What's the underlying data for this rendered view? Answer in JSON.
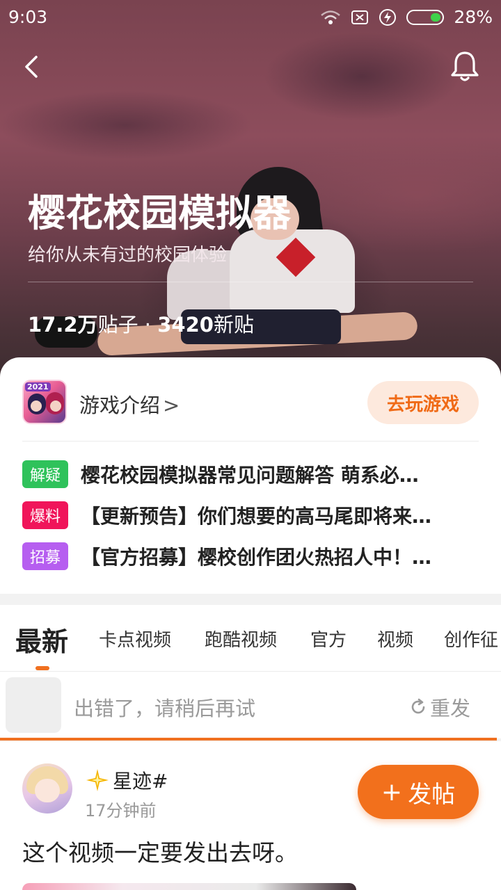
{
  "status_bar": {
    "time": "9:03",
    "battery": "28%"
  },
  "header": {
    "title": "樱花校园模拟器",
    "subtitle": "给你从未有过的校园体验",
    "stats": {
      "posts": "17.2万",
      "posts_label": "贴子",
      "separator": " · ",
      "new": "3420",
      "new_label": "新贴"
    }
  },
  "game_card": {
    "intro_label": "游戏介绍",
    "intro_chevron": ">",
    "icon_badge": "2021",
    "play_button": "去玩游戏"
  },
  "notices": [
    {
      "badge": "解疑",
      "badge_color": "#2fc25b",
      "text": "樱花校园模拟器常见问题解答 萌系必…"
    },
    {
      "badge": "爆料",
      "badge_color": "#f0155a",
      "text": "【更新预告】你们想要的高马尾即将来…"
    },
    {
      "badge": "招募",
      "badge_color": "#b65ef0",
      "text": "【官方招募】樱校创作团火热招人中！…"
    }
  ],
  "tabs": [
    {
      "label": "最新",
      "active": true
    },
    {
      "label": "卡点视频"
    },
    {
      "label": "跑酷视频"
    },
    {
      "label": "官方"
    },
    {
      "label": "视频"
    },
    {
      "label": "创作征"
    }
  ],
  "error_bar": {
    "message": "出错了，请稍后再试",
    "retry": "重发"
  },
  "post": {
    "username": "星迹#",
    "time": "17分钟前",
    "content": "这个视频一定要发出去呀。"
  },
  "fab": {
    "icon": "+",
    "label": "发帖"
  },
  "colors": {
    "accent": "#f2701c",
    "accent_light": "#fde9dd"
  }
}
